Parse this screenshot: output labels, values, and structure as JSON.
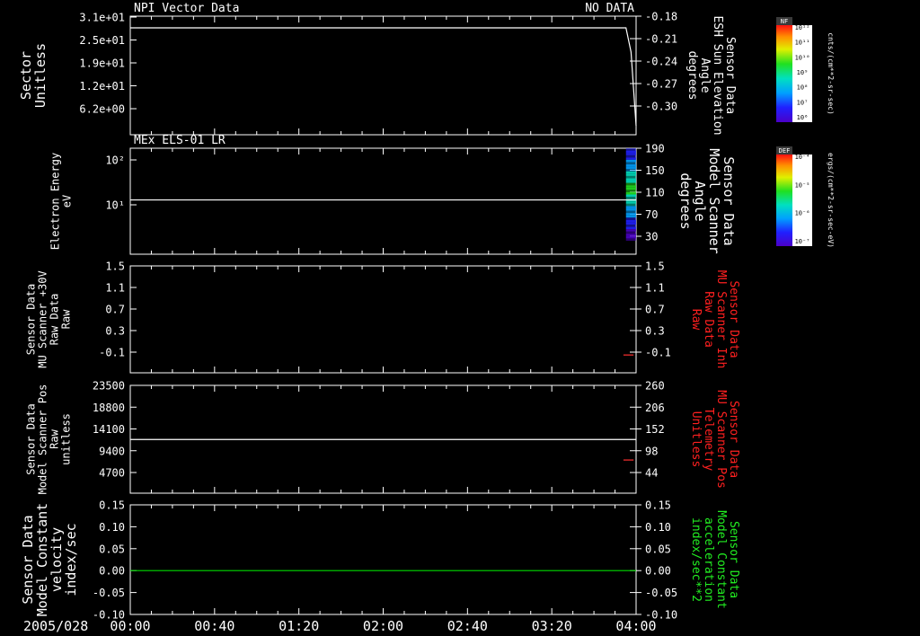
{
  "date_label": "2005/028",
  "time_ticks": [
    "00:00",
    "00:40",
    "01:20",
    "02:00",
    "02:40",
    "03:20",
    "04:00"
  ],
  "chart_data": [
    {
      "type": "line",
      "title": "NPI Vector Data",
      "status": "NO DATA",
      "ylabel": [
        "Sector",
        "Unitless"
      ],
      "yticks": [
        "3.1e+01",
        "2.5e+01",
        "1.9e+01",
        "1.2e+01",
        "6.2e+00"
      ],
      "ylim": [
        0,
        31
      ],
      "right_label": [
        "Sensor Data",
        "ESH Sun Elevation",
        "Angle",
        "degrees"
      ],
      "right_ticks": [
        "-0.18",
        "-0.21",
        "-0.24",
        "-0.27",
        "-0.30"
      ],
      "right_ylim": [
        -0.33,
        -0.18
      ],
      "series": [
        {
          "color": "#ffffff",
          "x": [
            0.0,
            3.92,
            3.96,
            4.0
          ],
          "y": [
            -0.184,
            -0.184,
            -0.22,
            -0.33
          ]
        }
      ]
    },
    {
      "type": "heatmap",
      "title": "MEx ELS-01 LR",
      "ylabel": [
        "Electron Energy",
        "eV"
      ],
      "yticks": [
        "10²",
        "10¹"
      ],
      "right_label": [
        "Sensor Data",
        "Model Scanner",
        "Angle",
        "degrees"
      ],
      "right_ticks": [
        "190",
        "150",
        "110",
        "70",
        "30"
      ],
      "right_ylim": [
        0,
        190
      ],
      "series": [
        {
          "color": "#ffffff",
          "x": [
            0.0,
            4.0
          ],
          "y": [
            100,
            100
          ]
        }
      ]
    },
    {
      "type": "line",
      "ylabel": [
        "Sensor Data",
        "MU Scanner +30V",
        "Raw Data",
        "Raw"
      ],
      "yticks": [
        "1.5",
        "1.1",
        "0.7",
        "0.3",
        "-0.1"
      ],
      "ylim": [
        -0.3,
        1.5
      ],
      "right_label": [
        "Sensor Data",
        "MU Scanner Inh",
        "Raw Data",
        "Raw"
      ],
      "right_ticks": [
        "1.5",
        "1.1",
        "0.7",
        "0.3",
        "-0.1"
      ],
      "right_ylim": [
        -0.3,
        1.5
      ],
      "series": [
        {
          "color": "#ff3030",
          "x": [
            3.9,
            3.98
          ],
          "y": [
            0.0,
            0.0
          ]
        }
      ]
    },
    {
      "type": "line",
      "ylabel": [
        "Sensor Data",
        "Model Scanner Pos",
        "Raw",
        "unitless"
      ],
      "yticks": [
        "23500",
        "18800",
        "14100",
        "9400",
        "4700"
      ],
      "ylim": [
        0,
        23500
      ],
      "right_label": [
        "Sensor Data",
        "MU Scanner Pos",
        "Telemetry",
        "Unitless"
      ],
      "right_ticks": [
        "260",
        "206",
        "152",
        "98",
        "44"
      ],
      "right_ylim": [
        0,
        260
      ],
      "series": [
        {
          "color": "#ffffff",
          "x": [
            0.0,
            4.0
          ],
          "y": [
            11700,
            11700
          ]
        },
        {
          "color": "#ff3030",
          "x": [
            3.9,
            3.98
          ],
          "y": [
            80,
            80
          ]
        }
      ]
    },
    {
      "type": "line",
      "ylabel": [
        "Sensor Data",
        "Model Constant",
        "velocity",
        "index/sec"
      ],
      "yticks": [
        "0.15",
        "0.10",
        "0.05",
        "0.00",
        "-0.05",
        "-0.10"
      ],
      "ylim": [
        -0.1,
        0.15
      ],
      "right_label": [
        "Sensor Data",
        "Model Constant",
        "acceleration",
        "index/sec**2"
      ],
      "right_ticks": [
        "0.15",
        "0.10",
        "0.05",
        "0.00",
        "-0.05",
        "-0.10"
      ],
      "right_ylim": [
        -0.1,
        0.15
      ],
      "series": [
        {
          "color": "#00dd00",
          "x": [
            0.0,
            4.0
          ],
          "y": [
            0.0,
            0.0
          ]
        }
      ]
    }
  ],
  "colorbars": [
    {
      "title": "NF",
      "unit": "cnts/(cm**2-sr-sec)",
      "ticks": [
        "10¹²",
        "10¹¹",
        "10¹⁰",
        "10⁹",
        "10⁸",
        "10⁷",
        "10⁶"
      ]
    },
    {
      "title": "DEF",
      "unit": "ergs/(cm**2-sr-sec-eV)",
      "ticks": [
        "10⁻⁴",
        "10⁻⁵",
        "10⁻⁶",
        "10⁻⁷"
      ]
    }
  ],
  "colors": {
    "frame": "#ffffff",
    "left_label": "#ffffff",
    "panel1_right": "#ffffff",
    "panel2_right": "#ffffff",
    "panel3_right": "#ff2020",
    "panel4_right": "#ff2020",
    "panel5_right": "#22ee22"
  }
}
